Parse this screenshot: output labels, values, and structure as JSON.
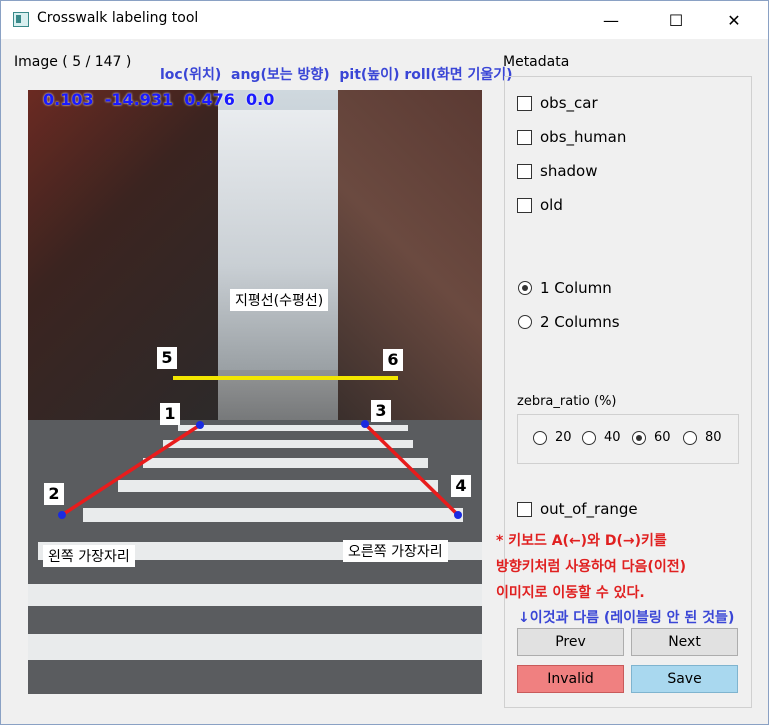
{
  "window": {
    "title": "Crosswalk labeling tool",
    "min_icon": "minimize-icon",
    "max_icon": "maximize-icon",
    "close_icon": "close-icon"
  },
  "image_panel": {
    "label": "Image ( 5 / 147 )"
  },
  "hint_blue": {
    "text": "loc(위치)  ang(보는 방향)  pit(높이) roll(화면 기울기)"
  },
  "pose_values": {
    "text": "0.103  -14.931  0.476  0.0"
  },
  "annotations": {
    "horizon_label": "지평선(수평선)",
    "left_edge_label": "왼쪽 가장자리",
    "right_edge_label": "오른쪽 가장자리",
    "points": [
      "1",
      "2",
      "3",
      "4",
      "5",
      "6"
    ]
  },
  "metadata": {
    "label": "Metadata",
    "checkboxes": [
      "obs_car",
      "obs_human",
      "shadow",
      "old"
    ],
    "columns": {
      "options": [
        "1 Column",
        "2 Columns"
      ],
      "selected": "1 Column"
    },
    "zebra_ratio_label": "zebra_ratio (%)",
    "zebra_options": [
      "20",
      "40",
      "60",
      "80"
    ],
    "zebra_selected": "60",
    "out_of_range": "out_of_range"
  },
  "note_red": {
    "line1": "* 키보드 A(←)와 D(→)키를",
    "line2": "방향키처럼 사용하여 다음(이전)",
    "line3": "이미지로 이동할 수 있다."
  },
  "note_blue": {
    "text": "↓이것과 다름 (레이블링 안 된 것들)"
  },
  "buttons": {
    "prev": "Prev",
    "next": "Next",
    "invalid": "Invalid",
    "save": "Save"
  },
  "colors": {
    "invalid_bg": "#f08080",
    "save_bg": "#a9d8ef",
    "edge_red": "#e81c1c",
    "horizon_yellow": "#f2e600",
    "point_blue": "#1a2be0"
  }
}
